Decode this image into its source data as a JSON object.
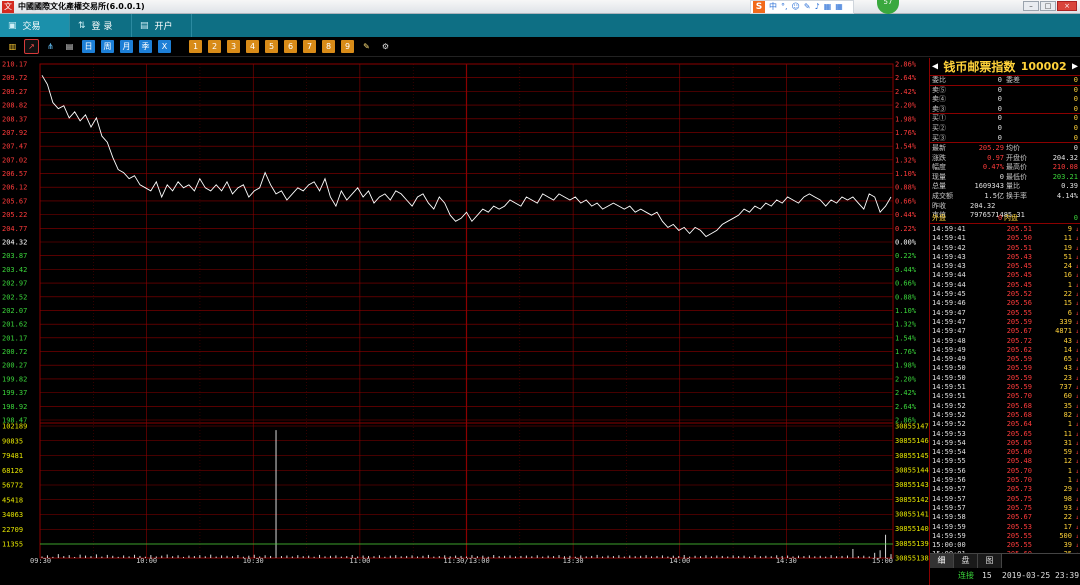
{
  "window": {
    "title": "中國國際文化產權交易所(6.0.0.1)",
    "ime_items": [
      "中",
      "°,",
      "☺",
      "✎",
      "♪",
      "▦",
      "▦"
    ],
    "badge": "57"
  },
  "main_tabs": [
    {
      "label": "交易",
      "icon": "trade-icon"
    },
    {
      "label": "登  录",
      "icon": "login-icon"
    },
    {
      "label": "开户",
      "icon": "account-icon"
    }
  ],
  "toolbar": {
    "buttons": [
      "bar-chart-icon",
      "line-chart-icon",
      "ticks-icon",
      "list-icon",
      "日",
      "周",
      "月",
      "季",
      "X",
      "1",
      "2",
      "3",
      "4",
      "5",
      "6",
      "7",
      "8",
      "9",
      "edit-icon",
      "gear-icon"
    ]
  },
  "chart_data": {
    "type": "line",
    "title": "",
    "prev_close": 204.32,
    "y_left_ticks": [
      "210.17",
      "209.72",
      "209.27",
      "208.82",
      "208.37",
      "207.92",
      "207.47",
      "207.02",
      "206.57",
      "206.12",
      "205.67",
      "205.22",
      "204.77",
      "204.32",
      "203.87",
      "203.42",
      "202.97",
      "202.52",
      "202.07",
      "201.62",
      "201.17",
      "200.72",
      "200.27",
      "199.82",
      "199.37",
      "198.92",
      "198.47"
    ],
    "y_right_ticks": [
      "2.86%",
      "2.64%",
      "2.42%",
      "2.20%",
      "1.98%",
      "1.76%",
      "1.54%",
      "1.32%",
      "1.10%",
      "0.88%",
      "0.66%",
      "0.44%",
      "0.22%",
      "0.00%",
      "0.22%",
      "0.44%",
      "0.66%",
      "0.88%",
      "1.10%",
      "1.32%",
      "1.54%",
      "1.76%",
      "1.98%",
      "2.20%",
      "2.42%",
      "2.64%",
      "2.86%"
    ],
    "x_ticks": [
      "09:30",
      "10:00",
      "10:30",
      "11:00",
      "11:30/13:00",
      "13:30",
      "14:00",
      "14:30",
      "15:00"
    ],
    "ylim": [
      198.47,
      210.17
    ],
    "price_series": [
      209.8,
      209.5,
      208.9,
      208.7,
      208.8,
      208.4,
      208.6,
      208.3,
      208.5,
      208.1,
      208.4,
      207.8,
      207.6,
      207.1,
      206.7,
      206.6,
      206.4,
      206.5,
      206.2,
      206.1,
      206.0,
      206.3,
      205.8,
      206.2,
      206.0,
      206.3,
      206.1,
      206.2,
      206.0,
      206.4,
      206.1,
      206.0,
      206.2,
      206.0,
      206.3,
      205.9,
      206.1,
      206.2,
      205.8,
      206.0,
      206.1,
      206.6,
      206.2,
      205.9,
      206.0,
      205.7,
      205.9,
      206.1,
      206.0,
      206.2,
      206.3,
      206.0,
      206.4,
      205.8,
      205.5,
      206.0,
      205.7,
      205.9,
      206.1,
      205.8,
      206.0,
      205.6,
      205.8,
      205.9,
      205.7,
      206.0,
      205.9,
      205.7,
      205.5,
      205.8,
      205.9,
      205.6,
      205.4,
      205.8,
      205.6,
      205.2,
      205.0,
      205.1,
      205.3,
      205.0,
      205.2,
      205.4,
      205.3,
      205.5,
      205.4,
      205.5,
      205.7,
      205.6,
      205.5,
      205.8,
      205.7,
      205.6,
      205.9,
      205.8,
      205.7,
      205.9,
      205.8,
      205.7,
      205.8,
      205.6,
      205.7,
      205.5,
      205.6,
      205.4,
      205.5,
      205.6,
      205.5,
      205.4,
      205.5,
      205.3,
      205.4,
      205.3,
      205.2,
      205.3,
      205.0,
      204.8,
      204.9,
      204.7,
      204.8,
      204.6,
      204.8,
      204.7,
      204.5,
      204.6,
      204.7,
      204.9,
      205.0,
      205.1,
      205.2,
      205.4,
      205.3,
      205.5,
      205.4,
      205.6,
      205.5,
      205.7,
      205.6,
      205.8,
      205.7,
      205.6,
      205.8,
      205.9,
      205.8,
      205.7,
      205.5,
      205.7,
      205.6,
      205.8,
      205.7,
      205.8,
      205.6,
      205.4,
      205.9,
      205.8,
      205.3,
      205.5,
      205.8
    ],
    "volume_left_ticks": [
      "102189",
      "90835",
      "79481",
      "68126",
      "56772",
      "45418",
      "34063",
      "22709",
      "11355"
    ],
    "volume_right_ticks": [
      "30855147",
      "30855146",
      "30855145",
      "30855144",
      "30855143",
      "30855142",
      "30855141",
      "30855140",
      "30855139",
      "30855138"
    ],
    "volume_ylim": [
      0,
      102189
    ],
    "volume_series": [
      1200,
      2100,
      900,
      3000,
      1500,
      2200,
      800,
      2600,
      1900,
      1400,
      2800,
      1100,
      2400,
      1700,
      900,
      2000,
      1300,
      2500,
      1600,
      1000,
      2300,
      1200,
      1800,
      2700,
      1400,
      2100,
      900,
      1900,
      1500,
      2200,
      1300,
      2600,
      1100,
      2000,
      1700,
      1400,
      2300,
      1000,
      1800,
      2500,
      1200,
      2100,
      1600,
      99000,
      1500,
      1900,
      1200,
      2200,
      1400,
      1800,
      1000,
      2400,
      1300,
      1700,
      2000,
      1100,
      1500,
      2300,
      1200,
      1900,
      1600,
      1400,
      2100,
      1000,
      1800,
      2200,
      1300,
      1600,
      2000,
      1200,
      1700,
      2400,
      1100,
      1500,
      2100,
      1300,
      1900,
      1600,
      1200,
      2200,
      1400,
      1800,
      1000,
      2300,
      1500,
      1700,
      2000,
      1200,
      1600,
      1900,
      1300,
      2100,
      1100,
      1800,
      1500,
      2200,
      1400,
      1700,
      1000,
      2000,
      1300,
      1600,
      2400,
      1200,
      1800,
      1500,
      2100,
      1100,
      1900,
      1400,
      1700,
      2200,
      1300,
      1600,
      2000,
      1200,
      1800,
      1500,
      2300,
      1100,
      1700,
      1400,
      2100,
      1300,
      1900,
      1600,
      1200,
      2000,
      1500,
      1800,
      1100,
      2200,
      1400,
      1700,
      1300,
      2100,
      1600,
      1900,
      1200,
      1800,
      1500,
      2000,
      1300,
      1700,
      1100,
      2200,
      1400,
      1600,
      1900,
      7000,
      1500,
      1800,
      1200,
      4000,
      6000,
      18000,
      3000
    ]
  },
  "panel": {
    "name": "钱币邮票指数",
    "code": "100002",
    "order_rows": [
      {
        "l1": "委比",
        "v1": "0",
        "l2": "委差",
        "v2": "0"
      },
      {
        "l1": "卖⑤",
        "v1": "0",
        "v2": "0"
      },
      {
        "l1": "卖④",
        "v1": "0",
        "v2": "0"
      },
      {
        "l1": "卖③",
        "v1": "0",
        "v2": "0"
      },
      {
        "l1": "买①",
        "v1": "0",
        "v2": "0"
      },
      {
        "l1": "买②",
        "v1": "0",
        "v2": "0"
      },
      {
        "l1": "买③",
        "v1": "0",
        "v2": "0"
      }
    ],
    "quote_rows": [
      {
        "l1": "最新",
        "v1": "205.29",
        "l2": "均价",
        "v2": "0"
      },
      {
        "l1": "涨跌",
        "v1": "0.97",
        "l2": "开盘价",
        "v2": "204.32"
      },
      {
        "l1": "幅度",
        "v1": "0.47%",
        "l2": "最高价",
        "v2": "210.08"
      },
      {
        "l1": "现量",
        "v1": "0",
        "l2": "最低价",
        "v2": "203.21"
      },
      {
        "l1": "总量",
        "v1": "1609343",
        "l2": "量比",
        "v2": "0.39"
      },
      {
        "l1": "成交额",
        "v1": "1.5亿",
        "l2": "换手率",
        "v2": "4.14%"
      },
      {
        "l1": "昨收",
        "v1": "204.32"
      },
      {
        "l1": "市值",
        "v1": "7976571485.31"
      }
    ],
    "outer_label": "外盘",
    "outer_value": "0",
    "inner_label": "内盘",
    "inner_value": "0",
    "ticks": [
      {
        "t": "14:59:41",
        "p": "205.51",
        "v": "9"
      },
      {
        "t": "14:59:41",
        "p": "205.50",
        "v": "11"
      },
      {
        "t": "14:59:42",
        "p": "205.51",
        "v": "19"
      },
      {
        "t": "14:59:43",
        "p": "205.43",
        "v": "51"
      },
      {
        "t": "14:59:43",
        "p": "205.45",
        "v": "24"
      },
      {
        "t": "14:59:44",
        "p": "205.45",
        "v": "16"
      },
      {
        "t": "14:59:44",
        "p": "205.45",
        "v": "1"
      },
      {
        "t": "14:59:45",
        "p": "205.52",
        "v": "22"
      },
      {
        "t": "14:59:46",
        "p": "205.56",
        "v": "15"
      },
      {
        "t": "14:59:47",
        "p": "205.55",
        "v": "6"
      },
      {
        "t": "14:59:47",
        "p": "205.59",
        "v": "339"
      },
      {
        "t": "14:59:47",
        "p": "205.67",
        "v": "4871"
      },
      {
        "t": "14:59:48",
        "p": "205.72",
        "v": "43"
      },
      {
        "t": "14:59:49",
        "p": "205.62",
        "v": "14"
      },
      {
        "t": "14:59:49",
        "p": "205.59",
        "v": "65"
      },
      {
        "t": "14:59:50",
        "p": "205.59",
        "v": "43"
      },
      {
        "t": "14:59:50",
        "p": "205.59",
        "v": "23"
      },
      {
        "t": "14:59:51",
        "p": "205.59",
        "v": "737"
      },
      {
        "t": "14:59:51",
        "p": "205.70",
        "v": "60"
      },
      {
        "t": "14:59:52",
        "p": "205.68",
        "v": "35"
      },
      {
        "t": "14:59:52",
        "p": "205.68",
        "v": "82"
      },
      {
        "t": "14:59:52",
        "p": "205.64",
        "v": "1"
      },
      {
        "t": "14:59:53",
        "p": "205.65",
        "v": "11"
      },
      {
        "t": "14:59:54",
        "p": "205.65",
        "v": "31"
      },
      {
        "t": "14:59:54",
        "p": "205.60",
        "v": "59"
      },
      {
        "t": "14:59:55",
        "p": "205.48",
        "v": "12"
      },
      {
        "t": "14:59:56",
        "p": "205.70",
        "v": "1"
      },
      {
        "t": "14:59:56",
        "p": "205.70",
        "v": "1"
      },
      {
        "t": "14:59:57",
        "p": "205.73",
        "v": "29"
      },
      {
        "t": "14:59:57",
        "p": "205.75",
        "v": "98"
      },
      {
        "t": "14:59:57",
        "p": "205.75",
        "v": "93"
      },
      {
        "t": "14:59:58",
        "p": "205.67",
        "v": "22"
      },
      {
        "t": "14:59:59",
        "p": "205.53",
        "v": "17"
      },
      {
        "t": "14:59:59",
        "p": "205.55",
        "v": "500"
      },
      {
        "t": "15:00:00",
        "p": "205.55",
        "v": "39"
      },
      {
        "t": "15:00:01",
        "p": "205.60",
        "v": "25"
      }
    ],
    "tabs": [
      "细",
      "盘",
      "图"
    ],
    "status": {
      "label": "连接",
      "count": "15",
      "datetime": "2019-03-25 23:39"
    }
  },
  "colors": {
    "grid": "#8b0000",
    "up": "#ff3b3b",
    "down": "#3ad43a",
    "line": "#ffffff",
    "volume": "#d9d9d9"
  }
}
